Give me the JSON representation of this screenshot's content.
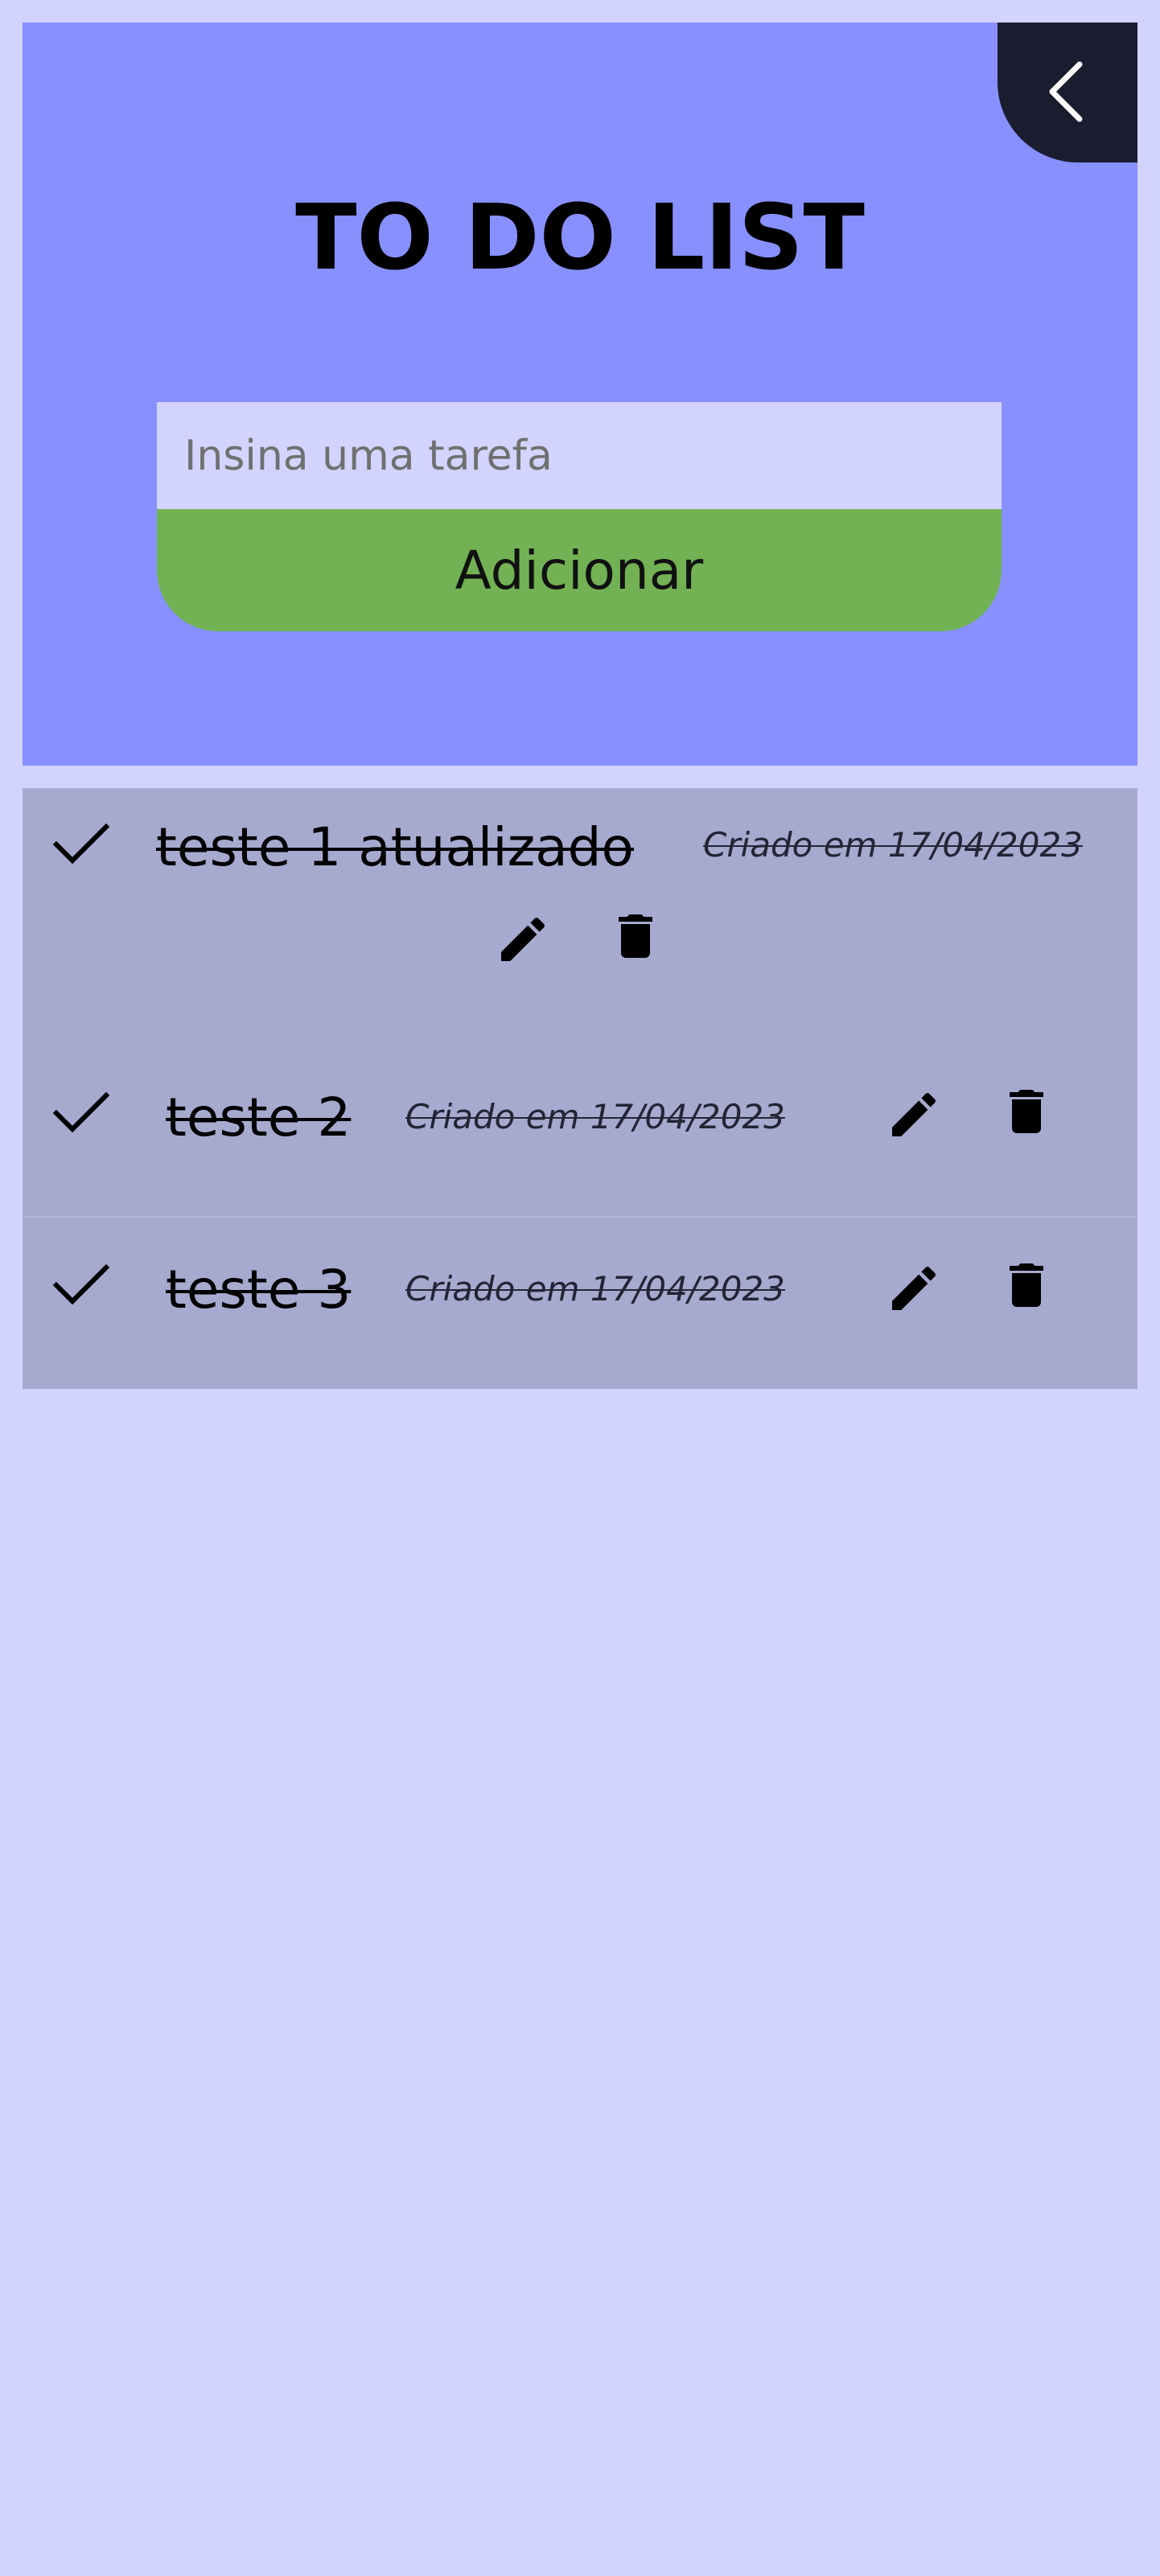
{
  "header": {
    "title": "TO DO LIST",
    "back_icon": "chevron-left-icon"
  },
  "form": {
    "placeholder": "Insina uma tarefa",
    "value": "",
    "add_label": "Adicionar"
  },
  "tasks": [
    {
      "text": "teste 1 atualizado",
      "date": "Criado em 17/04/2023",
      "completed": true
    },
    {
      "text": "teste 2",
      "date": "Criado em 17/04/2023",
      "completed": true
    },
    {
      "text": "teste 3",
      "date": "Criado em 17/04/2023",
      "completed": true
    }
  ],
  "icons": {
    "check": "check-icon",
    "edit": "pencil-icon",
    "delete": "trash-icon"
  },
  "colors": {
    "page_background": "#d3d3ff",
    "header_background": "#8890ff",
    "back_button": "#1b1c2f",
    "add_button": "#72b254",
    "task_background": "#a7aacf"
  }
}
